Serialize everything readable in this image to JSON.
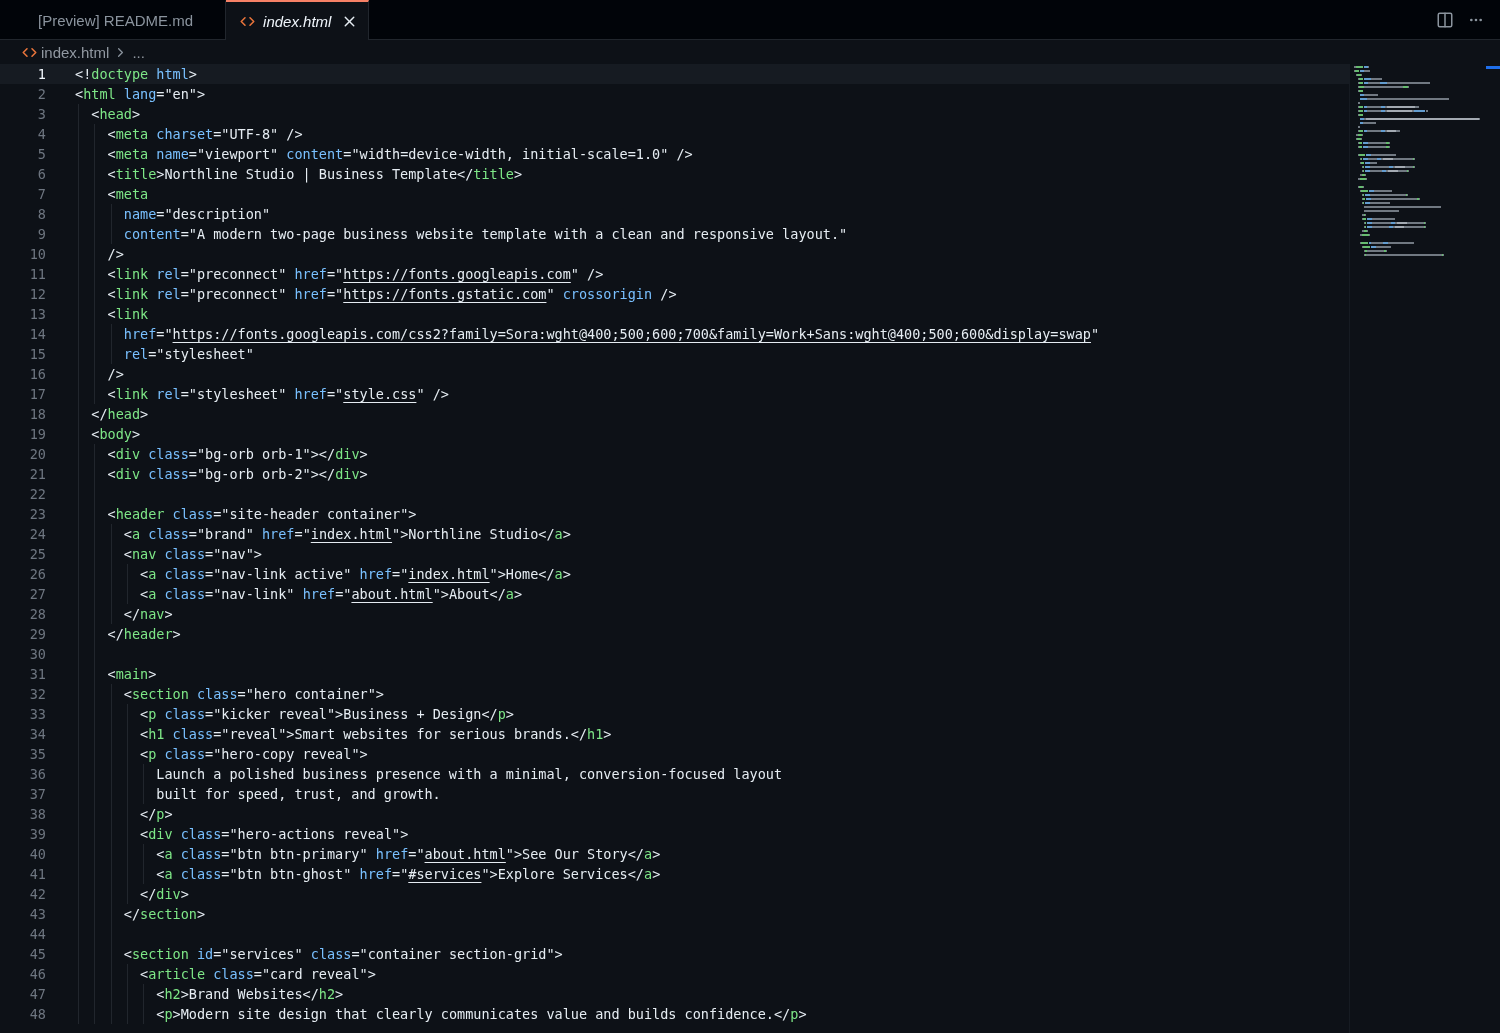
{
  "tabs": [
    {
      "label": "[Preview] README.md",
      "kind": "preview",
      "selected": false
    },
    {
      "label": "index.html",
      "kind": "html",
      "selected": true
    }
  ],
  "breadcrumb": {
    "file": "index.html",
    "more": "..."
  },
  "editor": {
    "lines": [
      {
        "number": "1",
        "active": true,
        "tokens": [
          {
            "kind": "plain",
            "text": "<!"
          },
          {
            "kind": "tag",
            "text": "doctype"
          },
          {
            "kind": "attr",
            "text": " html"
          },
          {
            "kind": "plain",
            "text": ">"
          }
        ]
      },
      {
        "number": "2",
        "active": false,
        "tokens": [
          {
            "kind": "plain",
            "text": "<"
          },
          {
            "kind": "tag",
            "text": "html"
          },
          {
            "kind": "attr",
            "text": " lang"
          },
          {
            "kind": "plain",
            "text": "=\"en\">"
          }
        ]
      },
      {
        "number": "3",
        "active": false,
        "tokens": [
          {
            "kind": "plain",
            "text": "  <"
          },
          {
            "kind": "tag",
            "text": "head"
          },
          {
            "kind": "plain",
            "text": ">"
          }
        ]
      },
      {
        "number": "4",
        "active": false,
        "tokens": [
          {
            "kind": "plain",
            "text": "    <"
          },
          {
            "kind": "tag",
            "text": "meta"
          },
          {
            "kind": "attr",
            "text": " charset"
          },
          {
            "kind": "plain",
            "text": "=\"UTF-8\" />"
          }
        ]
      },
      {
        "number": "5",
        "active": false,
        "tokens": [
          {
            "kind": "plain",
            "text": "    <"
          },
          {
            "kind": "tag",
            "text": "meta"
          },
          {
            "kind": "attr",
            "text": " name"
          },
          {
            "kind": "plain",
            "text": "=\"viewport\" "
          },
          {
            "kind": "attr",
            "text": "content"
          },
          {
            "kind": "plain",
            "text": "=\"width=device-width, initial-scale=1.0\" />"
          }
        ]
      },
      {
        "number": "6",
        "active": false,
        "tokens": [
          {
            "kind": "plain",
            "text": "    <"
          },
          {
            "kind": "tag",
            "text": "title"
          },
          {
            "kind": "plain",
            "text": ">Northline Studio | Business Template</"
          },
          {
            "kind": "tag",
            "text": "title"
          },
          {
            "kind": "plain",
            "text": ">"
          }
        ]
      },
      {
        "number": "7",
        "active": false,
        "tokens": [
          {
            "kind": "plain",
            "text": "    <"
          },
          {
            "kind": "tag",
            "text": "meta"
          }
        ]
      },
      {
        "number": "8",
        "active": false,
        "tokens": [
          {
            "kind": "attr",
            "text": "      name"
          },
          {
            "kind": "plain",
            "text": "=\"description\""
          }
        ]
      },
      {
        "number": "9",
        "active": false,
        "tokens": [
          {
            "kind": "attr",
            "text": "      content"
          },
          {
            "kind": "plain",
            "text": "=\"A modern two-page business website template with a clean and responsive layout.\""
          }
        ]
      },
      {
        "number": "10",
        "active": false,
        "tokens": [
          {
            "kind": "plain",
            "text": "    />"
          }
        ]
      },
      {
        "number": "11",
        "active": false,
        "tokens": [
          {
            "kind": "plain",
            "text": "    <"
          },
          {
            "kind": "tag",
            "text": "link"
          },
          {
            "kind": "attr",
            "text": " rel"
          },
          {
            "kind": "plain",
            "text": "=\"preconnect\" "
          },
          {
            "kind": "attr",
            "text": "href"
          },
          {
            "kind": "plain",
            "text": "=\""
          },
          {
            "kind": "link",
            "text": "https://fonts.googleapis.com"
          },
          {
            "kind": "plain",
            "text": "\" />"
          }
        ]
      },
      {
        "number": "12",
        "active": false,
        "tokens": [
          {
            "kind": "plain",
            "text": "    <"
          },
          {
            "kind": "tag",
            "text": "link"
          },
          {
            "kind": "attr",
            "text": " rel"
          },
          {
            "kind": "plain",
            "text": "=\"preconnect\" "
          },
          {
            "kind": "attr",
            "text": "href"
          },
          {
            "kind": "plain",
            "text": "=\""
          },
          {
            "kind": "link",
            "text": "https://fonts.gstatic.com"
          },
          {
            "kind": "plain",
            "text": "\" "
          },
          {
            "kind": "attr",
            "text": "crossorigin"
          },
          {
            "kind": "plain",
            "text": " />"
          }
        ]
      },
      {
        "number": "13",
        "active": false,
        "tokens": [
          {
            "kind": "plain",
            "text": "    <"
          },
          {
            "kind": "tag",
            "text": "link"
          }
        ]
      },
      {
        "number": "14",
        "active": false,
        "tokens": [
          {
            "kind": "attr",
            "text": "      href"
          },
          {
            "kind": "plain",
            "text": "=\""
          },
          {
            "kind": "link",
            "text": "https://fonts.googleapis.com/css2?family=Sora:wght@400;500;600;700&family=Work+Sans:wght@400;500;600&display=swap"
          },
          {
            "kind": "plain",
            "text": "\""
          }
        ]
      },
      {
        "number": "15",
        "active": false,
        "tokens": [
          {
            "kind": "attr",
            "text": "      rel"
          },
          {
            "kind": "plain",
            "text": "=\"stylesheet\""
          }
        ]
      },
      {
        "number": "16",
        "active": false,
        "tokens": [
          {
            "kind": "plain",
            "text": "    />"
          }
        ]
      },
      {
        "number": "17",
        "active": false,
        "tokens": [
          {
            "kind": "plain",
            "text": "    <"
          },
          {
            "kind": "tag",
            "text": "link"
          },
          {
            "kind": "attr",
            "text": " rel"
          },
          {
            "kind": "plain",
            "text": "=\"stylesheet\" "
          },
          {
            "kind": "attr",
            "text": "href"
          },
          {
            "kind": "plain",
            "text": "=\""
          },
          {
            "kind": "link",
            "text": "style.css"
          },
          {
            "kind": "plain",
            "text": "\" />"
          }
        ]
      },
      {
        "number": "18",
        "active": false,
        "tokens": [
          {
            "kind": "plain",
            "text": "  </"
          },
          {
            "kind": "tag",
            "text": "head"
          },
          {
            "kind": "plain",
            "text": ">"
          }
        ]
      },
      {
        "number": "19",
        "active": false,
        "tokens": [
          {
            "kind": "plain",
            "text": "  <"
          },
          {
            "kind": "tag",
            "text": "body"
          },
          {
            "kind": "plain",
            "text": ">"
          }
        ]
      },
      {
        "number": "20",
        "active": false,
        "tokens": [
          {
            "kind": "plain",
            "text": "    <"
          },
          {
            "kind": "tag",
            "text": "div"
          },
          {
            "kind": "attr",
            "text": " class"
          },
          {
            "kind": "plain",
            "text": "=\"bg-orb orb-1\"></"
          },
          {
            "kind": "tag",
            "text": "div"
          },
          {
            "kind": "plain",
            "text": ">"
          }
        ]
      },
      {
        "number": "21",
        "active": false,
        "tokens": [
          {
            "kind": "plain",
            "text": "    <"
          },
          {
            "kind": "tag",
            "text": "div"
          },
          {
            "kind": "attr",
            "text": " class"
          },
          {
            "kind": "plain",
            "text": "=\"bg-orb orb-2\"></"
          },
          {
            "kind": "tag",
            "text": "div"
          },
          {
            "kind": "plain",
            "text": ">"
          }
        ]
      },
      {
        "number": "22",
        "active": false
      },
      {
        "number": "23",
        "active": false,
        "tokens": [
          {
            "kind": "plain",
            "text": "    <"
          },
          {
            "kind": "tag",
            "text": "header"
          },
          {
            "kind": "attr",
            "text": " class"
          },
          {
            "kind": "plain",
            "text": "=\"site-header container\">"
          }
        ]
      },
      {
        "number": "24",
        "active": false,
        "tokens": [
          {
            "kind": "plain",
            "text": "      <"
          },
          {
            "kind": "tag",
            "text": "a"
          },
          {
            "kind": "attr",
            "text": " class"
          },
          {
            "kind": "plain",
            "text": "=\"brand\" "
          },
          {
            "kind": "attr",
            "text": "href"
          },
          {
            "kind": "plain",
            "text": "=\""
          },
          {
            "kind": "link",
            "text": "index.html"
          },
          {
            "kind": "plain",
            "text": "\">Northline Studio</"
          },
          {
            "kind": "tag",
            "text": "a"
          },
          {
            "kind": "plain",
            "text": ">"
          }
        ]
      },
      {
        "number": "25",
        "active": false,
        "tokens": [
          {
            "kind": "plain",
            "text": "      <"
          },
          {
            "kind": "tag",
            "text": "nav"
          },
          {
            "kind": "attr",
            "text": " class"
          },
          {
            "kind": "plain",
            "text": "=\"nav\">"
          }
        ]
      },
      {
        "number": "26",
        "active": false,
        "tokens": [
          {
            "kind": "plain",
            "text": "        <"
          },
          {
            "kind": "tag",
            "text": "a"
          },
          {
            "kind": "attr",
            "text": " class"
          },
          {
            "kind": "plain",
            "text": "=\"nav-link active\" "
          },
          {
            "kind": "attr",
            "text": "href"
          },
          {
            "kind": "plain",
            "text": "=\""
          },
          {
            "kind": "link",
            "text": "index.html"
          },
          {
            "kind": "plain",
            "text": "\">Home</"
          },
          {
            "kind": "tag",
            "text": "a"
          },
          {
            "kind": "plain",
            "text": ">"
          }
        ]
      },
      {
        "number": "27",
        "active": false,
        "tokens": [
          {
            "kind": "plain",
            "text": "        <"
          },
          {
            "kind": "tag",
            "text": "a"
          },
          {
            "kind": "attr",
            "text": " class"
          },
          {
            "kind": "plain",
            "text": "=\"nav-link\" "
          },
          {
            "kind": "attr",
            "text": "href"
          },
          {
            "kind": "plain",
            "text": "=\""
          },
          {
            "kind": "link",
            "text": "about.html"
          },
          {
            "kind": "plain",
            "text": "\">About</"
          },
          {
            "kind": "tag",
            "text": "a"
          },
          {
            "kind": "plain",
            "text": ">"
          }
        ]
      },
      {
        "number": "28",
        "active": false,
        "tokens": [
          {
            "kind": "plain",
            "text": "      </"
          },
          {
            "kind": "tag",
            "text": "nav"
          },
          {
            "kind": "plain",
            "text": ">"
          }
        ]
      },
      {
        "number": "29",
        "active": false,
        "tokens": [
          {
            "kind": "plain",
            "text": "    </"
          },
          {
            "kind": "tag",
            "text": "header"
          },
          {
            "kind": "plain",
            "text": ">"
          }
        ]
      },
      {
        "number": "30",
        "active": false
      },
      {
        "number": "31",
        "active": false,
        "tokens": [
          {
            "kind": "plain",
            "text": "    <"
          },
          {
            "kind": "tag",
            "text": "main"
          },
          {
            "kind": "plain",
            "text": ">"
          }
        ]
      },
      {
        "number": "32",
        "active": false,
        "tokens": [
          {
            "kind": "plain",
            "text": "      <"
          },
          {
            "kind": "tag",
            "text": "section"
          },
          {
            "kind": "attr",
            "text": " class"
          },
          {
            "kind": "plain",
            "text": "=\"hero container\">"
          }
        ]
      },
      {
        "number": "33",
        "active": false,
        "tokens": [
          {
            "kind": "plain",
            "text": "        <"
          },
          {
            "kind": "tag",
            "text": "p"
          },
          {
            "kind": "attr",
            "text": " class"
          },
          {
            "kind": "plain",
            "text": "=\"kicker reveal\">Business + Design</"
          },
          {
            "kind": "tag",
            "text": "p"
          },
          {
            "kind": "plain",
            "text": ">"
          }
        ]
      },
      {
        "number": "34",
        "active": false,
        "tokens": [
          {
            "kind": "plain",
            "text": "        <"
          },
          {
            "kind": "tag",
            "text": "h1"
          },
          {
            "kind": "attr",
            "text": " class"
          },
          {
            "kind": "plain",
            "text": "=\"reveal\">Smart websites for serious brands.</"
          },
          {
            "kind": "tag",
            "text": "h1"
          },
          {
            "kind": "plain",
            "text": ">"
          }
        ]
      },
      {
        "number": "35",
        "active": false,
        "tokens": [
          {
            "kind": "plain",
            "text": "        <"
          },
          {
            "kind": "tag",
            "text": "p"
          },
          {
            "kind": "attr",
            "text": " class"
          },
          {
            "kind": "plain",
            "text": "=\"hero-copy reveal\">"
          }
        ]
      },
      {
        "number": "36",
        "active": false,
        "tokens": [
          {
            "kind": "plain",
            "text": "          Launch a polished business presence with a minimal, conversion-focused layout"
          }
        ]
      },
      {
        "number": "37",
        "active": false,
        "tokens": [
          {
            "kind": "plain",
            "text": "          built for speed, trust, and growth."
          }
        ]
      },
      {
        "number": "38",
        "active": false,
        "tokens": [
          {
            "kind": "plain",
            "text": "        </"
          },
          {
            "kind": "tag",
            "text": "p"
          },
          {
            "kind": "plain",
            "text": ">"
          }
        ]
      },
      {
        "number": "39",
        "active": false,
        "tokens": [
          {
            "kind": "plain",
            "text": "        <"
          },
          {
            "kind": "tag",
            "text": "div"
          },
          {
            "kind": "attr",
            "text": " class"
          },
          {
            "kind": "plain",
            "text": "=\"hero-actions reveal\">"
          }
        ]
      },
      {
        "number": "40",
        "active": false,
        "tokens": [
          {
            "kind": "plain",
            "text": "          <"
          },
          {
            "kind": "tag",
            "text": "a"
          },
          {
            "kind": "attr",
            "text": " class"
          },
          {
            "kind": "plain",
            "text": "=\"btn btn-primary\" "
          },
          {
            "kind": "attr",
            "text": "href"
          },
          {
            "kind": "plain",
            "text": "=\""
          },
          {
            "kind": "link",
            "text": "about.html"
          },
          {
            "kind": "plain",
            "text": "\">See Our Story</"
          },
          {
            "kind": "tag",
            "text": "a"
          },
          {
            "kind": "plain",
            "text": ">"
          }
        ]
      },
      {
        "number": "41",
        "active": false,
        "tokens": [
          {
            "kind": "plain",
            "text": "          <"
          },
          {
            "kind": "tag",
            "text": "a"
          },
          {
            "kind": "attr",
            "text": " class"
          },
          {
            "kind": "plain",
            "text": "=\"btn btn-ghost\" "
          },
          {
            "kind": "attr",
            "text": "href"
          },
          {
            "kind": "plain",
            "text": "=\""
          },
          {
            "kind": "link",
            "text": "#services"
          },
          {
            "kind": "plain",
            "text": "\">Explore Services</"
          },
          {
            "kind": "tag",
            "text": "a"
          },
          {
            "kind": "plain",
            "text": ">"
          }
        ]
      },
      {
        "number": "42",
        "active": false,
        "tokens": [
          {
            "kind": "plain",
            "text": "        </"
          },
          {
            "kind": "tag",
            "text": "div"
          },
          {
            "kind": "plain",
            "text": ">"
          }
        ]
      },
      {
        "number": "43",
        "active": false,
        "tokens": [
          {
            "kind": "plain",
            "text": "      </"
          },
          {
            "kind": "tag",
            "text": "section"
          },
          {
            "kind": "plain",
            "text": ">"
          }
        ]
      },
      {
        "number": "44",
        "active": false
      },
      {
        "number": "45",
        "active": false,
        "tokens": [
          {
            "kind": "plain",
            "text": "      <"
          },
          {
            "kind": "tag",
            "text": "section"
          },
          {
            "kind": "attr",
            "text": " id"
          },
          {
            "kind": "plain",
            "text": "=\"services\" "
          },
          {
            "kind": "attr",
            "text": "class"
          },
          {
            "kind": "plain",
            "text": "=\"container section-grid\">"
          }
        ]
      },
      {
        "number": "46",
        "active": false,
        "tokens": [
          {
            "kind": "plain",
            "text": "        <"
          },
          {
            "kind": "tag",
            "text": "article"
          },
          {
            "kind": "attr",
            "text": " class"
          },
          {
            "kind": "plain",
            "text": "=\"card reveal\">"
          }
        ]
      },
      {
        "number": "47",
        "active": false,
        "tokens": [
          {
            "kind": "plain",
            "text": "          <"
          },
          {
            "kind": "tag",
            "text": "h2"
          },
          {
            "kind": "plain",
            "text": ">Brand Websites</"
          },
          {
            "kind": "tag",
            "text": "h2"
          },
          {
            "kind": "plain",
            "text": ">"
          }
        ]
      },
      {
        "number": "48",
        "active": false,
        "tokens": [
          {
            "kind": "plain",
            "text": "          <"
          },
          {
            "kind": "tag",
            "text": "p"
          },
          {
            "kind": "plain",
            "text": ">Modern site design that clearly communicates value and builds confidence.</"
          },
          {
            "kind": "tag",
            "text": "p"
          },
          {
            "kind": "plain",
            "text": ">"
          }
        ]
      }
    ]
  }
}
